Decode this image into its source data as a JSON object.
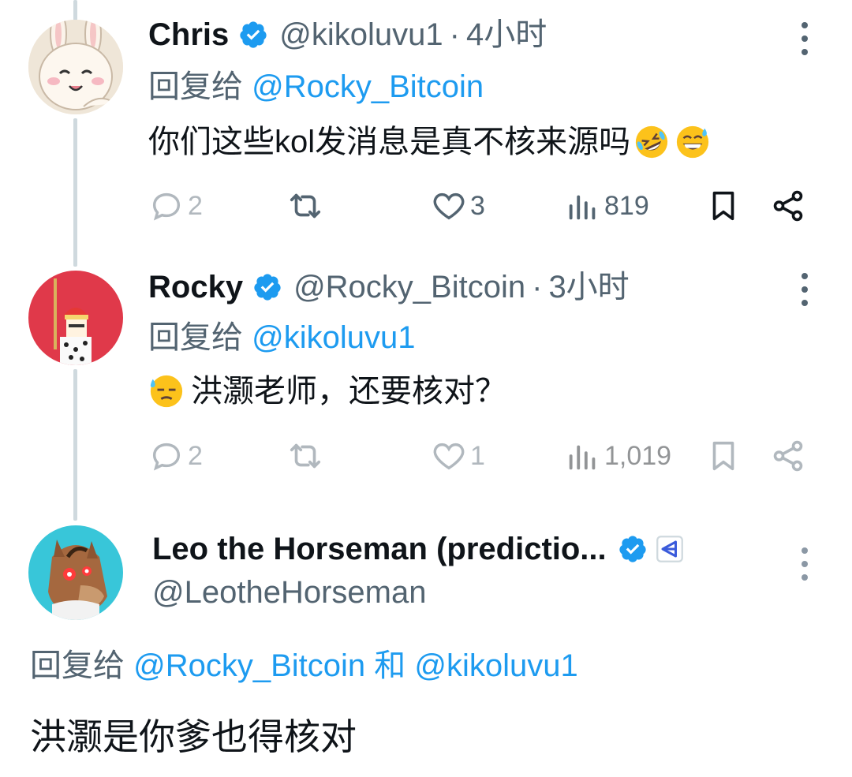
{
  "colors": {
    "accent": "#1d9bf0",
    "text": "#0f1419",
    "muted": "#536471",
    "line": "#cfd9de"
  },
  "tweets": [
    {
      "name": "Chris",
      "handle": "@kikoluvu1",
      "dot": "·",
      "time": "4小时",
      "reply_label": "回复给",
      "reply_targets": [
        "@Rocky_Bitcoin"
      ],
      "text": "你们这些kol发消息是真不核来源吗",
      "emojis": [
        "rolling-laughing-emoji",
        "grinning-sweat-emoji"
      ],
      "replies": "2",
      "reposts": "",
      "likes": "3",
      "views": "819"
    },
    {
      "name": "Rocky",
      "handle": "@Rocky_Bitcoin",
      "dot": "·",
      "time": "3小时",
      "reply_label": "回复给",
      "reply_targets": [
        "@kikoluvu1"
      ],
      "leading_emoji": "downcast-sweat-emoji",
      "text": "洪灏老师，还要核对？",
      "replies": "2",
      "reposts": "",
      "likes": "1",
      "views": "1,019"
    },
    {
      "name": "Leo the Horseman (predictio...",
      "handle": "@LeotheHorseman",
      "reply_label": "回复给",
      "reply_targets": [
        "@Rocky_Bitcoin",
        "@kikoluvu1"
      ],
      "reply_joiner": "和",
      "text": "洪灏是你爹也得核对"
    }
  ]
}
